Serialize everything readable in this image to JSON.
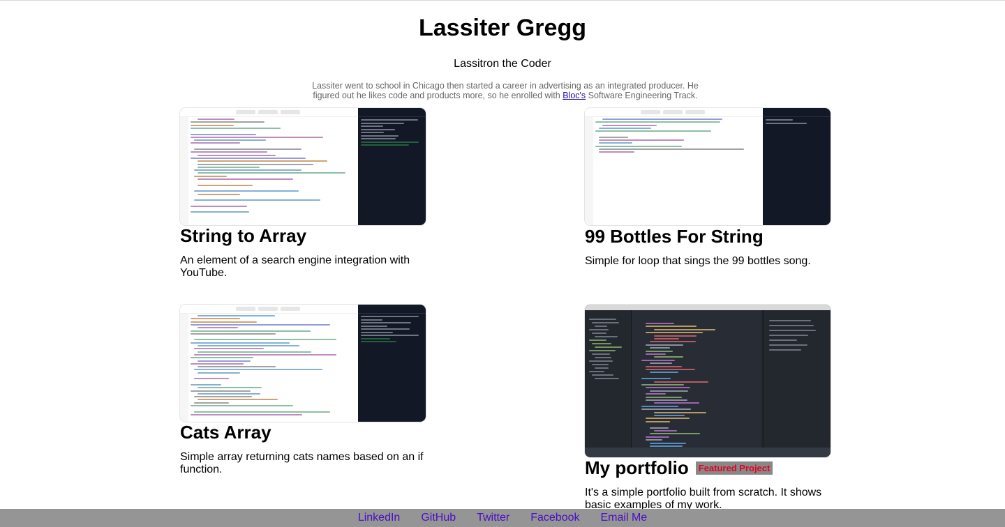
{
  "header": {
    "name": "Lassiter Gregg",
    "tagline": "Lassitron the Coder",
    "bio_before": "Lassiter went to school in Chicago then started a career in advertising as an integrated producer. He figured out he likes code and products more, so he enrolled with ",
    "bio_link": "Bloc's",
    "bio_after": " Software Engineering Track."
  },
  "projects": [
    {
      "title": "String to Array",
      "description": "An element of a search engine integration with YouTube."
    },
    {
      "title": "99 Bottles For String",
      "description": "Simple for loop that sings the 99 bottles song."
    },
    {
      "title": "Cats Array",
      "description": "Simple array returning cats names based on an if function."
    },
    {
      "title": "My portfolio",
      "badge": "Featured Project",
      "description": "It's a simple portfolio built from scratch. It shows basic examples of my work."
    }
  ],
  "footer": {
    "links": [
      "LinkedIn",
      "GitHub",
      "Twitter",
      "Facebook",
      "Email Me"
    ]
  },
  "colors": {
    "footer_bg": "#959595",
    "footer_link": "#4b0fc4",
    "badge_bg": "#888888",
    "badge_text": "#e60023"
  }
}
